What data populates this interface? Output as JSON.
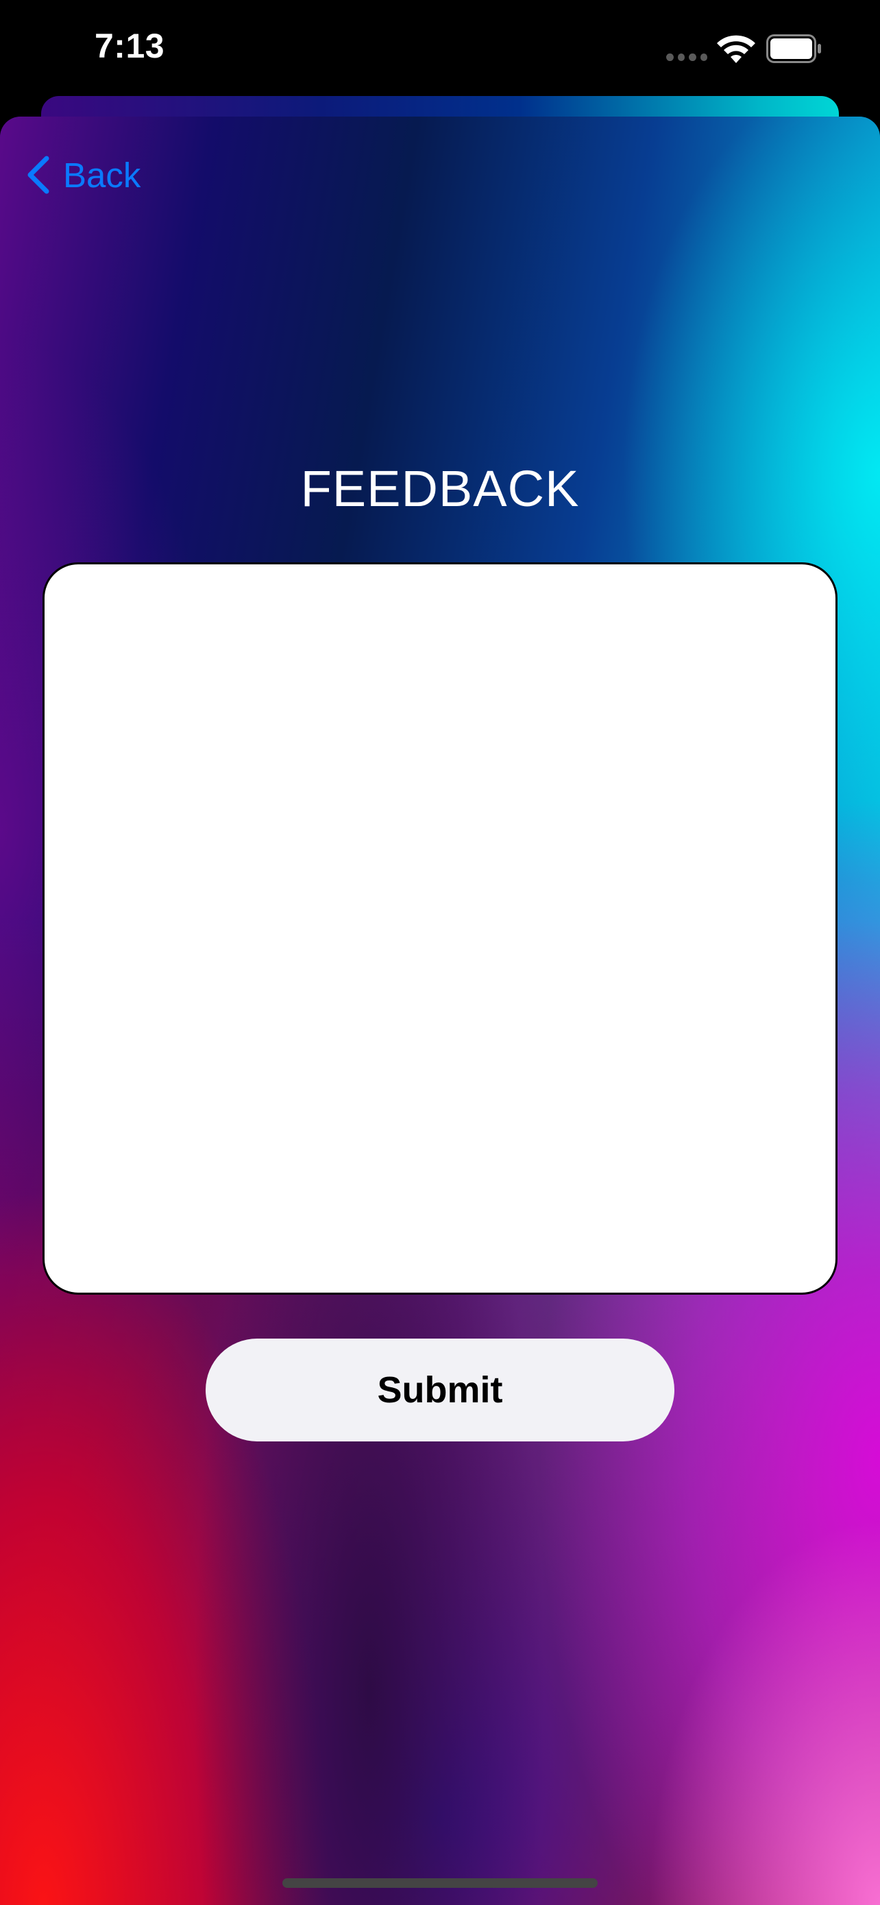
{
  "status_bar": {
    "time": "7:13",
    "cellular_icon": "cellular-signal-icon",
    "wifi_icon": "wifi-icon",
    "battery_icon": "battery-full-icon"
  },
  "nav": {
    "back_label": "Back",
    "back_icon": "chevron-left-icon"
  },
  "page": {
    "title": "FEEDBACK"
  },
  "form": {
    "feedback_value": "",
    "submit_label": "Submit"
  },
  "colors": {
    "accent_blue": "#0a7aff",
    "button_bg": "#f2f2f6",
    "title_text": "#ffffff"
  }
}
